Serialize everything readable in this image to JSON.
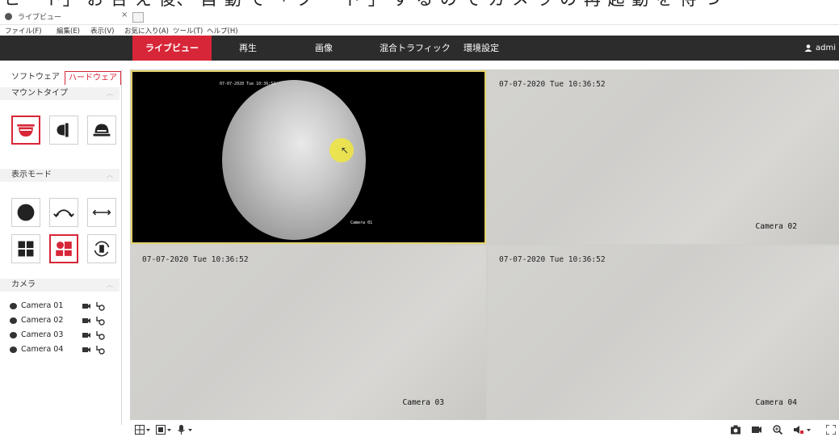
{
  "caption": "ヒー ト」 お 台 え 後、 自 動 で 「 ク ー ド 」 す る の で カ メ ラ の 再 起 動 を 待 つ",
  "browser": {
    "tab_title": "ライブビュー",
    "tab_close": "×",
    "menu": [
      "ファイル(F)",
      "編集(E)",
      "表示(V)",
      "お気に入り(A)",
      "ツール(T)",
      "ヘルプ(H)"
    ]
  },
  "nav": {
    "items": [
      "ライブビュー",
      "再生",
      "画像",
      "混合トラフィック",
      "環境設定"
    ],
    "active_index": 0,
    "user": "admi"
  },
  "sidebar": {
    "tabs": [
      "ソフトウェア",
      "ハードウェア"
    ],
    "active_tab": 1,
    "mount_type_label": "マウントタイプ",
    "display_mode_label": "表示モード",
    "camera_label": "カメラ",
    "mount_icons": [
      "ceiling-mount-icon",
      "wall-mount-icon",
      "desktop-mount-icon"
    ],
    "mode_icons": [
      "fisheye-view-icon",
      "panorama-180-icon",
      "panorama-360-icon",
      "quad-view-icon",
      "fisheye-ptz-view-icon",
      "rotate-view-icon"
    ],
    "cameras": [
      "Camera 01",
      "Camera 02",
      "Camera 03",
      "Camera 04"
    ]
  },
  "panes": [
    {
      "timestamp": "07-07-2020 Tue 10:36:52",
      "label": "Camera 01"
    },
    {
      "timestamp": "07-07-2020 Tue 10:36:52",
      "label": "Camera 02"
    },
    {
      "timestamp": "07-07-2020 Tue 10:36:52",
      "label": "Camera 03"
    },
    {
      "timestamp": "07-07-2020 Tue 10:36:52",
      "label": "Camera 04"
    }
  ],
  "colors": {
    "accent": "#d72637",
    "navbar": "#2c2c2c"
  },
  "toolbar": {
    "left": [
      "layout-grid-icon",
      "stream-icon",
      "microphone-icon"
    ],
    "right": [
      "snapshot-icon",
      "record-icon",
      "zoom-icon",
      "volume-icon",
      "fullscreen-icon"
    ]
  }
}
